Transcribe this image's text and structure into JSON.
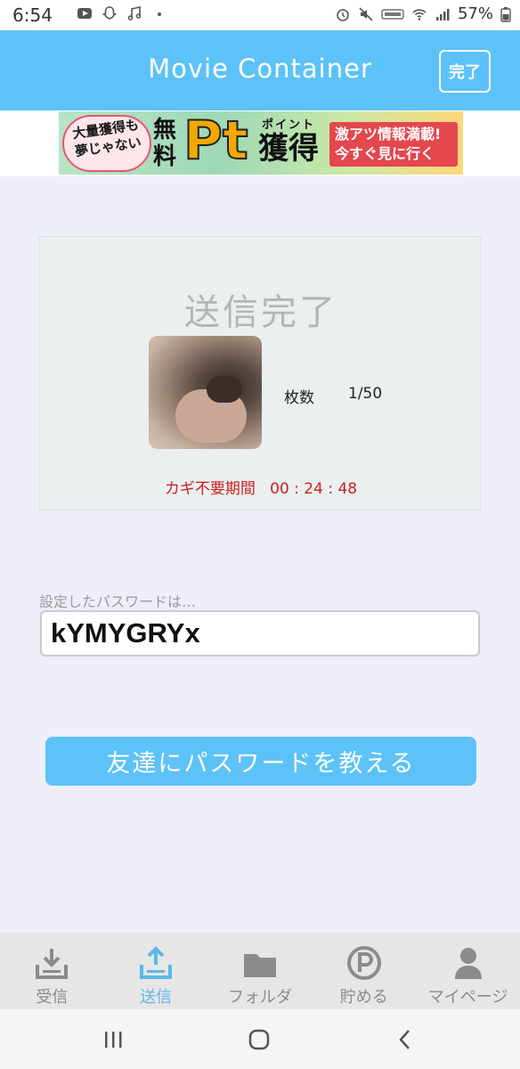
{
  "status_bar": {
    "time": "6:54",
    "battery": "57%",
    "left_icons": [
      "youtube-icon",
      "snapchat-icon",
      "music-icon",
      "dot-icon"
    ],
    "right_icons": [
      "alarm-icon",
      "mute-icon",
      "volte-icon",
      "wifi-icon",
      "signal-icon",
      "battery-icon"
    ]
  },
  "header": {
    "title": "Movie Container",
    "done_label": "完了"
  },
  "ad": {
    "burst_text": "大量獲得も夢じゃない",
    "free_text": "無料",
    "pt_text": "Pt",
    "point_text": "ポイント",
    "gain_text": "獲得",
    "cta_line1": "激アツ情報満載!",
    "cta_line2": "今すぐ見に行く"
  },
  "sent": {
    "title": "送信完了",
    "count_label": "枚数",
    "count_value": "1/50",
    "key_period_label": "カギ不要期間",
    "key_period_value": "00 : 24 : 48"
  },
  "password": {
    "caption": "設定したパスワードは…",
    "value": "kYMYGRYx"
  },
  "share_button_label": "友達にパスワードを教える",
  "tabs": [
    {
      "label": "受信",
      "icon": "download-tray-icon",
      "active": false
    },
    {
      "label": "送信",
      "icon": "upload-tray-icon",
      "active": true
    },
    {
      "label": "フォルダ",
      "icon": "folder-icon",
      "active": false
    },
    {
      "label": "貯める",
      "icon": "points-p-icon",
      "active": false
    },
    {
      "label": "マイページ",
      "icon": "user-icon",
      "active": false
    }
  ],
  "colors": {
    "accent": "#5dc2f7",
    "tab_active": "#5db8e6",
    "warning_red": "#cc1f1f"
  }
}
